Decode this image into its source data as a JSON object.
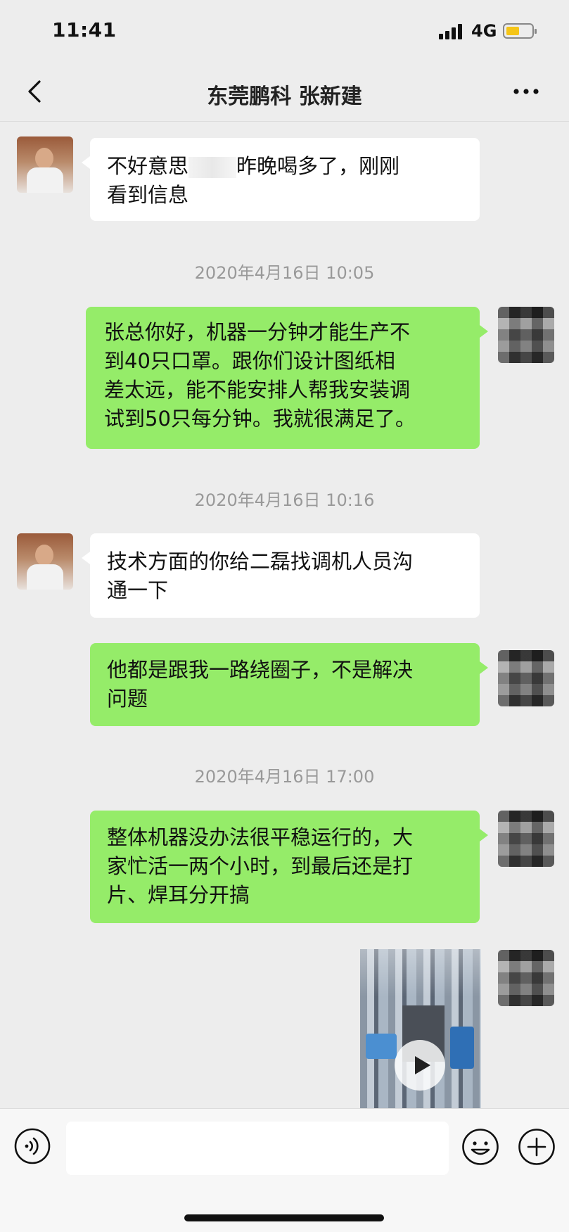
{
  "status": {
    "time": "11:41",
    "network": "4G",
    "battery_color": "#f5c518"
  },
  "header": {
    "title": "东莞鹏科 张新建",
    "back_icon": "chevron-left-icon",
    "more_icon": "ellipsis-icon"
  },
  "messages": [
    {
      "side": "left",
      "line1_before": "不好意思",
      "line1_after": "昨晚喝多了，刚刚",
      "line2": "看到信息"
    },
    {
      "timestamp": "2020年4月16日 10:05"
    },
    {
      "side": "right",
      "lines": [
        "张总你好，机器一分钟才能生产不",
        "到40只口罩。跟你们设计图纸相",
        "差太远，能不能安排人帮我安装调",
        "试到50只每分钟。我就很满足了。"
      ]
    },
    {
      "timestamp": "2020年4月16日 10:16"
    },
    {
      "side": "left",
      "lines": [
        "技术方面的你给二磊找调机人员沟",
        "通一下"
      ]
    },
    {
      "side": "right",
      "lines": [
        "他都是跟我一路绕圈子，不是解决",
        "问题"
      ]
    },
    {
      "timestamp": "2020年4月16日 17:00"
    },
    {
      "side": "right",
      "lines": [
        "整体机器没办法很平稳运行的，大",
        "家忙活一两个小时，到最后还是打",
        "片、焊耳分开搞"
      ]
    },
    {
      "side": "right",
      "type": "video",
      "icon": "play-icon"
    }
  ],
  "input_bar": {
    "voice_icon": "voice-icon",
    "emoji_icon": "emoji-icon",
    "plus_icon": "plus-icon"
  },
  "colors": {
    "background": "#ededed",
    "bubble_self": "#95ec69",
    "bubble_other": "#ffffff",
    "timestamp": "#999999"
  }
}
